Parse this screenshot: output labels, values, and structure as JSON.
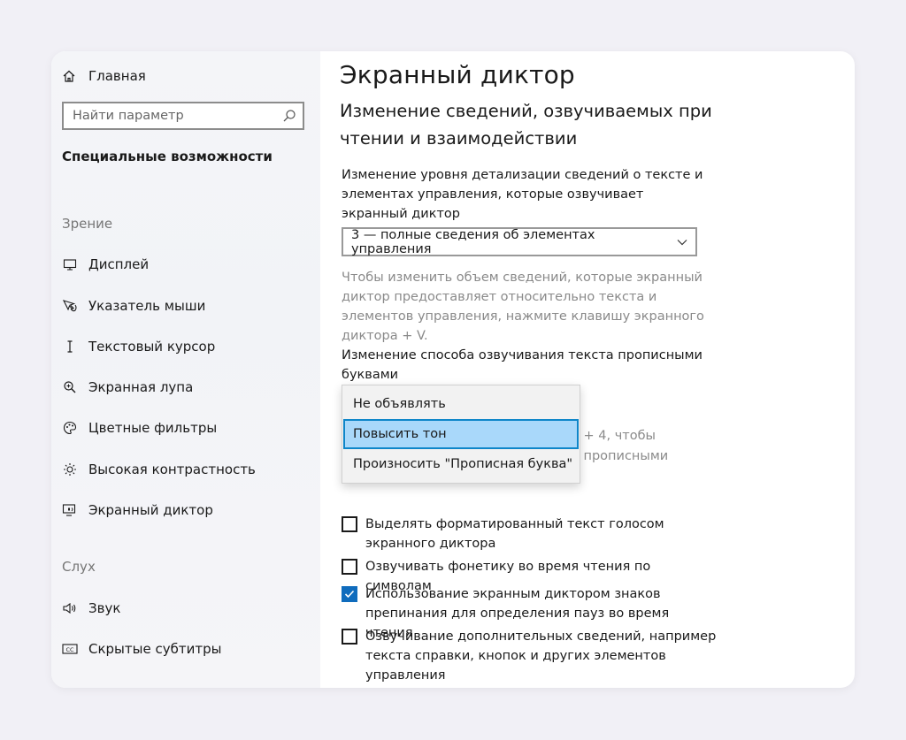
{
  "sidebar": {
    "home_label": "Главная",
    "search_placeholder": "Найти параметр",
    "section_title": "Специальные возможности",
    "groups": [
      {
        "label": "Зрение",
        "items": [
          {
            "label": "Дисплей",
            "icon": "monitor-icon"
          },
          {
            "label": "Указатель мыши",
            "icon": "mouse-pointer-icon"
          },
          {
            "label": "Текстовый курсор",
            "icon": "text-cursor-icon"
          },
          {
            "label": "Экранная лупа",
            "icon": "magnifier-icon"
          },
          {
            "label": "Цветные фильтры",
            "icon": "palette-icon"
          },
          {
            "label": "Высокая контрастность",
            "icon": "sun-icon"
          },
          {
            "label": "Экранный диктор",
            "icon": "narrator-icon",
            "active": true
          }
        ]
      },
      {
        "label": "Слух",
        "items": [
          {
            "label": "Звук",
            "icon": "speaker-icon"
          },
          {
            "label": "Скрытые субтитры",
            "icon": "closed-captions-icon"
          }
        ]
      }
    ]
  },
  "main": {
    "page_title": "Экранный диктор",
    "subtitle": "Изменение сведений, озвучиваемых при чтении и взаимодействии",
    "detail_label": "Изменение уровня детализации сведений о тексте и элементах управления, которые озвучивает экранный диктор",
    "detail_select_value": "3 — полные сведения об элементах управления",
    "detail_hint": "Чтобы изменить объем сведений, которые экранный диктор предоставляет относительно текста и элементов управления, нажмите клавишу экранного диктора + V.",
    "capitals_label": "Изменение способа озвучивания текста прописными буквами",
    "capitals_options": [
      "Не объявлять",
      "Повысить тон",
      "Произносить \"Прописная буква\""
    ],
    "capitals_selected": "Повысить тон",
    "behind_text": {
      "line1": "а + 4, чтобы",
      "line2": "а прописными"
    },
    "checkboxes": [
      {
        "label": "Выделять форматированный текст голосом экранного диктора",
        "checked": false
      },
      {
        "label": "Озвучивать фонетику во время чтения по символам",
        "checked": false
      },
      {
        "label": "Использование экранным диктором знаков препинания для определения пауз во время чтения",
        "checked": true
      },
      {
        "label": "Озвучивание дополнительных сведений, например текста справки, кнопок и других элементов управления",
        "checked": false
      }
    ]
  },
  "colors": {
    "accent": "#0f6cbd",
    "dropdown_highlight": "#a9d8fa",
    "dropdown_focus_border": "#0e86c9",
    "hint_text": "#8a8a8a"
  }
}
